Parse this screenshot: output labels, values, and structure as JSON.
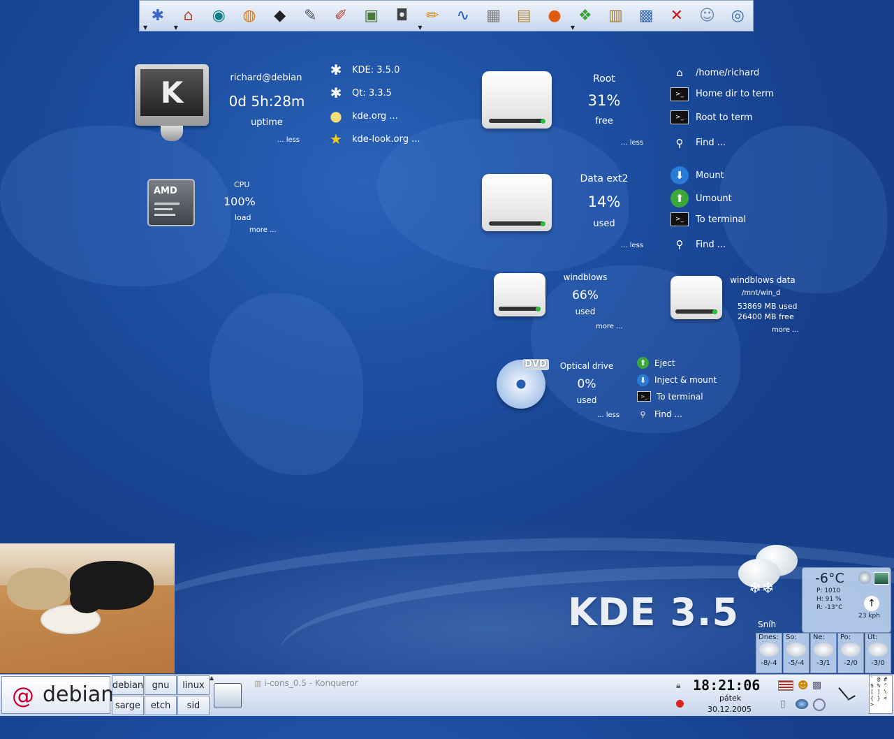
{
  "kicker": {
    "buttons": [
      {
        "name": "kmenu-icon",
        "glyph": "✱",
        "color": "#3a66c4",
        "arrow": true
      },
      {
        "name": "home-icon",
        "glyph": "⌂",
        "color": "#b4472e",
        "arrow": true
      },
      {
        "name": "web-browser-icon",
        "glyph": "◉",
        "color": "#0e7d86",
        "arrow": false
      },
      {
        "name": "blender-icon",
        "glyph": "◍",
        "color": "#e07a10",
        "arrow": false
      },
      {
        "name": "inkscape-icon",
        "glyph": "◆",
        "color": "#222222",
        "arrow": false
      },
      {
        "name": "gimp-icon",
        "glyph": "✎",
        "color": "#555555",
        "arrow": false
      },
      {
        "name": "paint-icon",
        "glyph": "✐",
        "color": "#c43a2a",
        "arrow": false
      },
      {
        "name": "image-viewer-icon",
        "glyph": "▣",
        "color": "#4a7a3a",
        "arrow": false
      },
      {
        "name": "camera-icon",
        "glyph": "◘",
        "color": "#444444",
        "arrow": false
      },
      {
        "name": "editor-icon",
        "glyph": "✏",
        "color": "#d08a10",
        "arrow": true
      },
      {
        "name": "office-icon",
        "glyph": "∿",
        "color": "#1a57b0",
        "arrow": false
      },
      {
        "name": "spreadsheet-icon",
        "glyph": "▦",
        "color": "#777777",
        "arrow": false
      },
      {
        "name": "archive-icon",
        "glyph": "▤",
        "color": "#b08a40",
        "arrow": false
      },
      {
        "name": "media-player-icon",
        "glyph": "●",
        "color": "#e05a10",
        "arrow": false
      },
      {
        "name": "games-icon",
        "glyph": "❖",
        "color": "#3aa03a",
        "arrow": true
      },
      {
        "name": "file-manager-icon",
        "glyph": "▥",
        "color": "#a07a30",
        "arrow": false
      },
      {
        "name": "network-icon",
        "glyph": "▩",
        "color": "#3a6ab0",
        "arrow": false
      },
      {
        "name": "close-icon",
        "glyph": "✕",
        "color": "#d01010",
        "arrow": false
      },
      {
        "name": "user-icon",
        "glyph": "☺",
        "color": "#6a8ab0",
        "arrow": false
      },
      {
        "name": "globe-icon",
        "glyph": "◎",
        "color": "#2a6ab8",
        "arrow": false
      }
    ]
  },
  "system": {
    "user_host": "richard@debian",
    "uptime_value": "0d 5h:28m",
    "uptime_label": "uptime",
    "less": "... less",
    "info": [
      {
        "text": "KDE: 3.5.0",
        "icon": "kde-icon"
      },
      {
        "text": "Qt: 3.3.5",
        "icon": "kde-icon"
      },
      {
        "text": "kde.org ...",
        "icon": "lightbulb-icon"
      },
      {
        "text": "kde-look.org ...",
        "icon": "star-icon"
      }
    ]
  },
  "cpu": {
    "badge": "AMD",
    "title": "CPU",
    "value": "100%",
    "label": "load",
    "more": "more ..."
  },
  "root_drive": {
    "title": "Root",
    "value": "31%",
    "label": "free",
    "less": "... less",
    "actions": [
      "/home/richard",
      "Home dir to term",
      "Root to term",
      "Find ..."
    ]
  },
  "data_drive": {
    "title": "Data ext2",
    "value": "14%",
    "label": "used",
    "less": "... less",
    "actions": [
      "Mount",
      "Umount",
      "To terminal",
      "Find ..."
    ]
  },
  "windblows": {
    "title": "windblows",
    "value": "66%",
    "label": "used",
    "more": "more ..."
  },
  "windblows_data": {
    "title": "windblows data",
    "path": "/mnt/win_d",
    "used": "53869  MB used",
    "free": "26400  MB free",
    "more": "more ..."
  },
  "optical": {
    "badge": "DVD",
    "title": "Optical drive",
    "value": "0%",
    "label": "used",
    "less": "... less",
    "actions": [
      "Eject",
      "Inject & mount",
      "To terminal",
      "Find ..."
    ]
  },
  "wallpaper_logo": "KDE 3.5",
  "weather": {
    "temp": "-6°C",
    "p": "P:  1010",
    "h": "H:  91 %",
    "r": "R:  -13°C",
    "wind": "23 kph",
    "condition": "Sníh",
    "days": [
      {
        "day": "Dnes:",
        "temp": "-8/-4"
      },
      {
        "day": "So:",
        "temp": "-5/-4"
      },
      {
        "day": "Ne:",
        "temp": "-3/1"
      },
      {
        "day": "Po:",
        "temp": "-2/0"
      },
      {
        "day": "Út:",
        "temp": "-3/0"
      }
    ]
  },
  "panel": {
    "logo": "debian",
    "desktops": [
      "debian",
      "gnu",
      "linux",
      "sarge",
      "etch",
      "sid"
    ],
    "task": "i-cons_0.5 - Konqueror",
    "clock_time": "18:21:06",
    "clock_day": "pátek",
    "clock_date": "30.12.2005"
  },
  "colors": {
    "desktop": "#1d4fa3",
    "accent": "#2c6ad0"
  }
}
